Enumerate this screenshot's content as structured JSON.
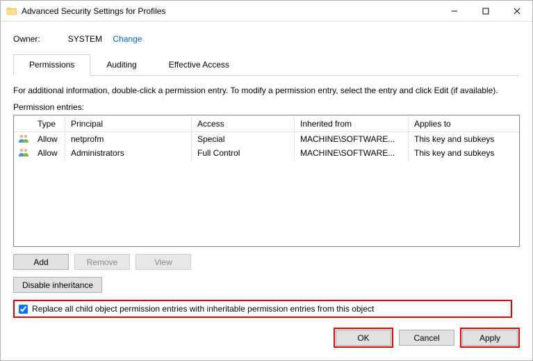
{
  "window": {
    "title": "Advanced Security Settings for Profiles"
  },
  "owner": {
    "label": "Owner:",
    "value": "SYSTEM",
    "change": "Change"
  },
  "tabs": {
    "permissions": "Permissions",
    "auditing": "Auditing",
    "effective": "Effective Access"
  },
  "info": "For additional information, double-click a permission entry. To modify a permission entry, select the entry and click Edit (if available).",
  "entries_label": "Permission entries:",
  "columns": {
    "type": "Type",
    "principal": "Principal",
    "access": "Access",
    "inherited": "Inherited from",
    "applies": "Applies to"
  },
  "entries": [
    {
      "type": "Allow",
      "principal": "netprofm",
      "access": "Special",
      "inherited": "MACHINE\\SOFTWARE...",
      "applies": "This key and subkeys"
    },
    {
      "type": "Allow",
      "principal": "Administrators",
      "access": "Full Control",
      "inherited": "MACHINE\\SOFTWARE...",
      "applies": "This key and subkeys"
    }
  ],
  "buttons": {
    "add": "Add",
    "remove": "Remove",
    "view": "View",
    "disable_inh": "Disable inheritance",
    "ok": "OK",
    "cancel": "Cancel",
    "apply": "Apply"
  },
  "checkbox_label": "Replace all child object permission entries with inheritable permission entries from this object"
}
